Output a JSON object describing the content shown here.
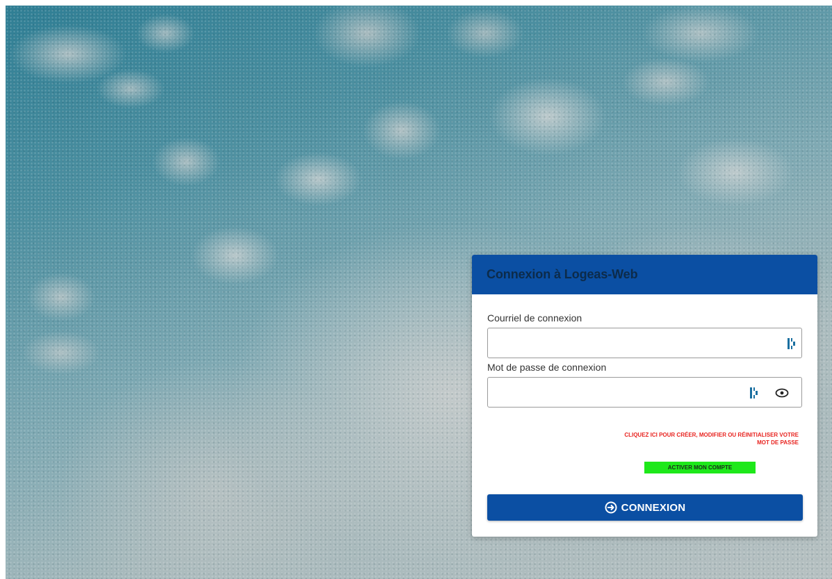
{
  "login_card": {
    "title": "Connexion à Logeas-Web",
    "email": {
      "label": "Courriel de connexion",
      "value": "",
      "icon": "password-manager-icon"
    },
    "password": {
      "label": "Mot de passe de connexion",
      "value": "",
      "icons": [
        "password-manager-icon",
        "eye-icon"
      ]
    },
    "reset_password_link": "Cliquez ici pour créer, modifier ou réinitialiser votre mot de passe",
    "activate_account_button": "Activer mon compte",
    "login_button": {
      "label": "CONNEXION",
      "icon": "login-icon"
    }
  },
  "colors": {
    "primary": "#0b4fa3",
    "link_red": "#e8231f",
    "activate_green": "#1ee81a",
    "background_teal": "#3f879a"
  }
}
